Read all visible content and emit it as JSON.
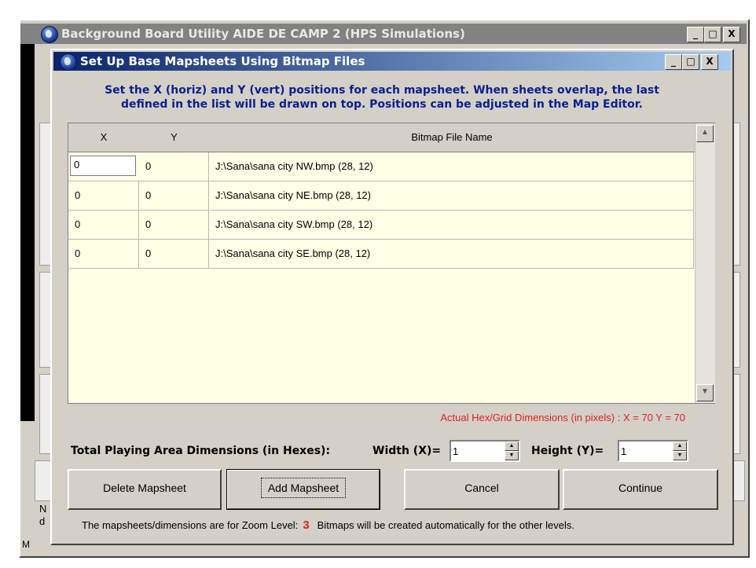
{
  "outer_window": {
    "title": "Background Board Utility  AIDE DE CAMP 2  (HPS Simulations)",
    "controls": [
      "_",
      "□",
      "X"
    ],
    "left_letters": [
      "N",
      "d"
    ],
    "bottom_letter": "M"
  },
  "dialog": {
    "title": "Set Up Base Mapsheets Using Bitmap Files",
    "controls": [
      "_",
      "□",
      "X"
    ],
    "instructions_line1": "Set the X (horiz) and Y (vert) positions for each mapsheet.  When sheets overlap, the last",
    "instructions_line2": "defined in the list will be drawn on top.  Positions can be adjusted in the Map Editor.",
    "grid": {
      "columns": [
        "X",
        "Y",
        "Bitmap File Name"
      ],
      "rows": [
        {
          "x": "0",
          "y": "0",
          "file": "J:\\Sana\\sana city NW.bmp  (28, 12)"
        },
        {
          "x": "0",
          "y": "0",
          "file": "J:\\Sana\\sana city NE.bmp  (28, 12)"
        },
        {
          "x": "0",
          "y": "0",
          "file": "J:\\Sana\\sana city SW.bmp  (28, 12)"
        },
        {
          "x": "0",
          "y": "0",
          "file": "J:\\Sana\\sana city SE.bmp  (28, 12)"
        }
      ],
      "scroll_up_icon": "scroll-up-arrow",
      "scroll_down_icon": "scroll-down-arrow"
    },
    "actual_dims": "Actual Hex/Grid Dimensions (in pixels) :   X = 70   Y = 70",
    "total_label": "Total Playing Area Dimensions (in Hexes):",
    "width_label": "Width (X)=",
    "width_value": "1",
    "height_label": "Height (Y)=",
    "height_value": "1",
    "buttons": {
      "delete": "Delete Mapsheet",
      "add": "Add Mapsheet",
      "cancel": "Cancel",
      "continue": "Continue"
    },
    "footer_pre": "The mapsheets/dimensions are for Zoom Level:",
    "zoom_level": "3",
    "footer_post": "Bitmaps will be created automatically for the other levels."
  },
  "colors": {
    "dialog_bg": "#d4d0c8",
    "grid_bg": "#ffffe6",
    "instruction_text": "#0a1f8f",
    "accent_red": "#e02020",
    "title_active": "#0a246a",
    "title_inactive": "#828282"
  }
}
